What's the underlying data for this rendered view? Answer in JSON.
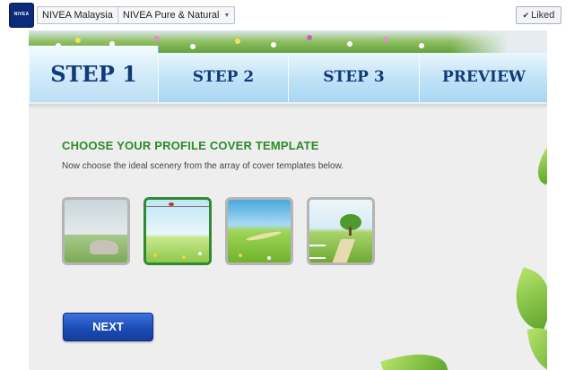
{
  "topbar": {
    "logo_text": "NIVEA",
    "breadcrumb": [
      "NIVEA Malaysia",
      "NIVEA Pure & Natural"
    ],
    "breadcrumb_caret": "▼",
    "liked_check": "✔",
    "liked_label": "Liked"
  },
  "steps": [
    {
      "label": "STEP 1",
      "active": true
    },
    {
      "label": "STEP 2",
      "active": false
    },
    {
      "label": "STEP 3",
      "active": false
    },
    {
      "label": "PREVIEW",
      "active": false
    }
  ],
  "content": {
    "heading": "CHOOSE YOUR PROFILE COVER TEMPLATE",
    "subheading": "Now choose the ideal scenery from the array of cover templates below.",
    "templates": [
      {
        "name": "cloudy-meadow-rocks",
        "selected": false
      },
      {
        "name": "open-field-bird",
        "selected": true
      },
      {
        "name": "green-hills-path",
        "selected": false
      },
      {
        "name": "tree-fence-path",
        "selected": false
      }
    ],
    "next_label": "NEXT"
  },
  "colors": {
    "heading_green": "#2c8a2a",
    "step_text_blue": "#123a78",
    "selected_border": "#2f8a33",
    "button_blue": "#1c4bb6"
  }
}
